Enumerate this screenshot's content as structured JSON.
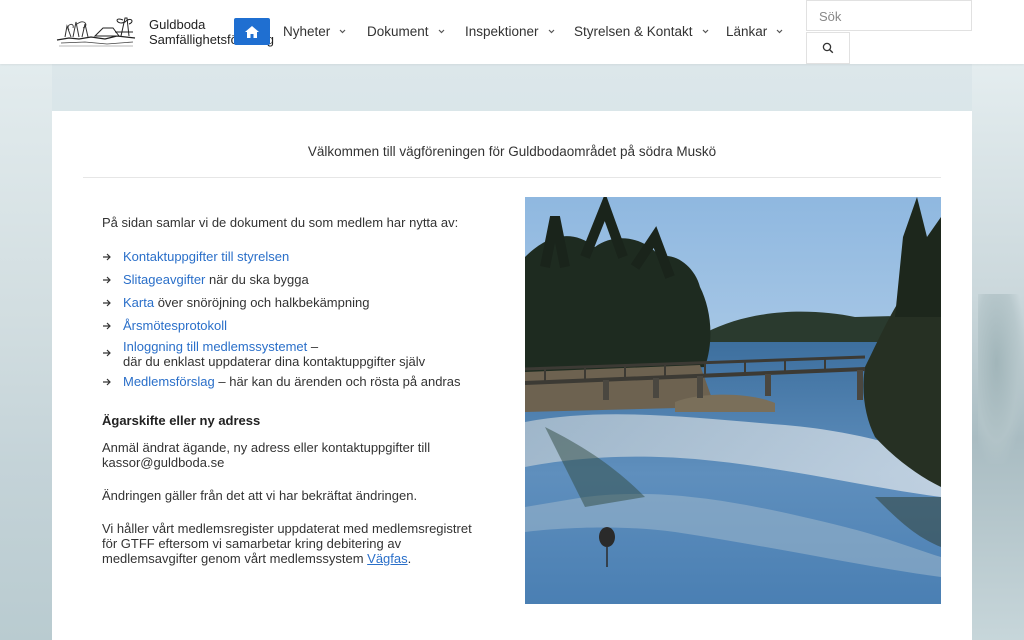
{
  "site": {
    "name_line1": "Guldboda",
    "name_line2": "Samfällighetsförening"
  },
  "nav": {
    "items": [
      {
        "label": "Nyheter"
      },
      {
        "label": "Dokument"
      },
      {
        "label": "Inspektioner"
      },
      {
        "label": "Styrelsen & Kontakt"
      },
      {
        "label": "Länkar"
      }
    ]
  },
  "search": {
    "placeholder": "Sök"
  },
  "main": {
    "title": "Välkommen till vägföreningen för Guldbodaområdet på södra Muskö",
    "intro": "På sidan samlar vi de dokument du som medlem har nytta av:",
    "links": [
      {
        "link": "Kontaktuppgifter till styrelsen",
        "rest": ""
      },
      {
        "link": "Slitageavgifter",
        "rest": " när du ska bygga"
      },
      {
        "link": "Karta",
        "rest": " över snöröjning och halkbekämpning"
      },
      {
        "link": "Årsmötesprotokoll",
        "rest": ""
      },
      {
        "link": "Inloggning till medlemssystemet",
        "rest": " –",
        "line2": "där du enklast uppdaterar dina kontaktuppgifter själv"
      },
      {
        "link": "Medlemsförslag",
        "rest": " – här kan du ärenden och rösta på andras"
      }
    ],
    "ownership_heading": "Ägarskifte eller ny adress",
    "ownership_p1": "Anmäl ändrat ägande, ny adress eller kontaktuppgifter till kassor@guldboda.se",
    "ownership_p2": "Ändringen gäller från det att vi har bekräftat ändringen.",
    "ownership_p3_text": "Vi håller vårt medlemsregister uppdaterat med medlemsregistret för GTFF eftersom vi samarbetar kring debitering av medlemsavgifter genom vårt medlemssystem ",
    "ownership_p3_link": "Vägfas",
    "ownership_p3_end": "."
  },
  "colors": {
    "accent": "#1f6fd1",
    "link": "#2a6fc9"
  },
  "icons": {
    "home": "home-icon",
    "search": "search-icon",
    "chevron": "chevron-down-icon",
    "arrow": "arrow-right-icon"
  }
}
